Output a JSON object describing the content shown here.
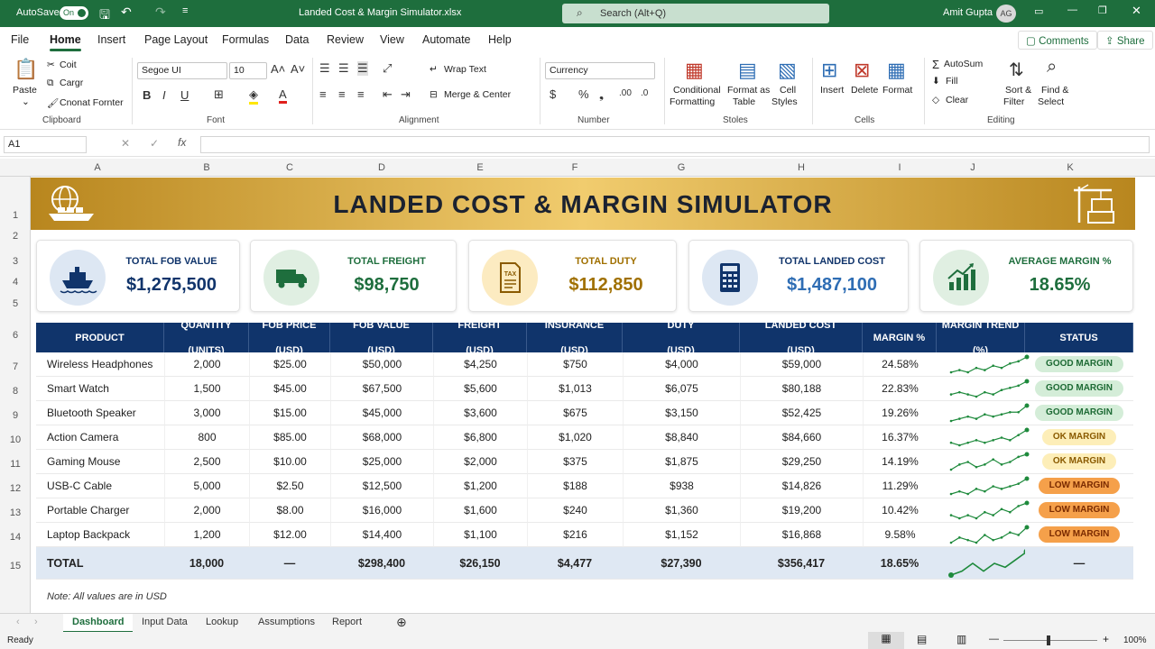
{
  "titlebar": {
    "autosave": "AutoSave",
    "toggle": "On",
    "filename": "Landed Cost & Margin Simulator.xlsx",
    "search": "Search (Alt+Q)",
    "user": "Amit Gupta",
    "initials": "AG"
  },
  "menu": [
    "File",
    "Home",
    "Insert",
    "Page Layout",
    "Formulas",
    "Data",
    "Review",
    "View",
    "Automate",
    "Help"
  ],
  "comments": "Comments",
  "share": "Share",
  "ribbon": {
    "paste": "Paste",
    "cut": "Coit",
    "copy": "Cargr",
    "format_painter": "Cnonat Fornter",
    "font_name": "Segoe UI",
    "font_size": "10",
    "wrap": "Wrap Text",
    "merge": "Merge & Center",
    "number_format": "Currency",
    "cond1": "Conditional",
    "cond2": "Formatting",
    "fmt1": "Format as",
    "fmt2": "Table",
    "cs1": "Cell",
    "cs2": "Styles",
    "insert": "Insert",
    "delete": "Delete",
    "format": "Format",
    "autosum": "AutoSum",
    "fill": "Fill",
    "clear": "Clear",
    "sort1": "Sort &",
    "sort2": "Filter",
    "find1": "Find &",
    "find2": "Select",
    "groups": {
      "clipboard": "Clipboard",
      "font": "Font",
      "alignment": "Alignment",
      "number": "Number",
      "styles": "Stoles",
      "cells": "Cells",
      "editing": "Editing"
    }
  },
  "namebox": "A1",
  "columns": [
    "A",
    "B",
    "C",
    "D",
    "E",
    "F",
    "G",
    "H",
    "I",
    "J",
    "K"
  ],
  "rows": [
    "1",
    "2",
    "3",
    "4",
    "5",
    "6",
    "7",
    "8",
    "9",
    "10",
    "11",
    "12",
    "13",
    "14",
    "15"
  ],
  "banner_title": "LANDED COST & MARGIN SIMULATOR",
  "kpis": [
    {
      "label": "TOTAL FOB VALUE",
      "value": "$1,275,500"
    },
    {
      "label": "TOTAL FREIGHT",
      "value": "$98,750"
    },
    {
      "label": "TOTAL DUTY",
      "value": "$112,850",
      "tax": "TAX"
    },
    {
      "label": "TOTAL LANDED COST",
      "value": "$1,487,100"
    },
    {
      "label": "AVERAGE MARGIN %",
      "value": "18.65%"
    }
  ],
  "headers": [
    {
      "l1": "PRODUCT",
      "l2": ""
    },
    {
      "l1": "QUANTITY",
      "l2": "(UNITS)"
    },
    {
      "l1": "FOB PRICE",
      "l2": "(USD)"
    },
    {
      "l1": "FOB VALUE",
      "l2": "(USD)"
    },
    {
      "l1": "FREIGHT",
      "l2": "(USD)"
    },
    {
      "l1": "INSURANCE",
      "l2": "(USD)"
    },
    {
      "l1": "DUTY",
      "l2": "(USD)"
    },
    {
      "l1": "LANDED COST",
      "l2": "(USD)"
    },
    {
      "l1": "MARGIN %",
      "l2": ""
    },
    {
      "l1": "MARGIN TREND",
      "l2": "(%)"
    },
    {
      "l1": "STATUS",
      "l2": ""
    }
  ],
  "products": [
    {
      "name": "Wireless Headphones",
      "qty": "2,000",
      "price": "$25.00",
      "fob": "$50,000",
      "freight": "$4,250",
      "ins": "$750",
      "duty": "$4,000",
      "landed": "$59,000",
      "margin": "24.58%",
      "status": "GOOD MARGIN",
      "trend": [
        2,
        3,
        2,
        4,
        3,
        5,
        4,
        6,
        7,
        9
      ]
    },
    {
      "name": "Smart Watch",
      "qty": "1,500",
      "price": "$45.00",
      "fob": "$67,500",
      "freight": "$5,600",
      "ins": "$1,013",
      "duty": "$6,075",
      "landed": "$80,188",
      "margin": "22.83%",
      "status": "GOOD MARGIN",
      "trend": [
        3,
        4,
        3,
        2,
        4,
        3,
        5,
        6,
        7,
        9
      ]
    },
    {
      "name": "Bluetooth Speaker",
      "qty": "3,000",
      "price": "$15.00",
      "fob": "$45,000",
      "freight": "$3,600",
      "ins": "$675",
      "duty": "$3,150",
      "landed": "$52,425",
      "margin": "19.26%",
      "status": "GOOD MARGIN",
      "trend": [
        2,
        3,
        4,
        3,
        5,
        4,
        5,
        6,
        6,
        9
      ]
    },
    {
      "name": "Action Camera",
      "qty": "800",
      "price": "$85.00",
      "fob": "$68,000",
      "freight": "$6,800",
      "ins": "$1,020",
      "duty": "$8,840",
      "landed": "$84,660",
      "margin": "16.37%",
      "status": "OK MARGIN",
      "trend": [
        3,
        2,
        3,
        4,
        3,
        4,
        5,
        4,
        6,
        8
      ]
    },
    {
      "name": "Gaming Mouse",
      "qty": "2,500",
      "price": "$10.00",
      "fob": "$25,000",
      "freight": "$2,000",
      "ins": "$375",
      "duty": "$1,875",
      "landed": "$29,250",
      "margin": "14.19%",
      "status": "OK MARGIN",
      "trend": [
        2,
        4,
        5,
        3,
        4,
        6,
        4,
        5,
        7,
        8
      ]
    },
    {
      "name": "USB-C Cable",
      "qty": "5,000",
      "price": "$2.50",
      "fob": "$12,500",
      "freight": "$1,200",
      "ins": "$188",
      "duty": "$938",
      "landed": "$14,826",
      "margin": "11.29%",
      "status": "LOW MARGIN",
      "trend": [
        2,
        3,
        2,
        4,
        3,
        5,
        4,
        5,
        6,
        8
      ]
    },
    {
      "name": "Portable Charger",
      "qty": "2,000",
      "price": "$8.00",
      "fob": "$16,000",
      "freight": "$1,600",
      "ins": "$240",
      "duty": "$1,360",
      "landed": "$19,200",
      "margin": "10.42%",
      "status": "LOW MARGIN",
      "trend": [
        3,
        2,
        3,
        2,
        4,
        3,
        5,
        4,
        6,
        7
      ]
    },
    {
      "name": "Laptop Backpack",
      "qty": "1,200",
      "price": "$12.00",
      "fob": "$14,400",
      "freight": "$1,100",
      "ins": "$216",
      "duty": "$1,152",
      "landed": "$16,868",
      "margin": "9.58%",
      "status": "LOW MARGIN",
      "trend": [
        2,
        4,
        3,
        2,
        5,
        3,
        4,
        6,
        5,
        8
      ]
    }
  ],
  "total": {
    "name": "TOTAL",
    "qty": "18,000",
    "price": "—",
    "fob": "$298,400",
    "freight": "$26,150",
    "ins": "$4,477",
    "duty": "$27,390",
    "landed": "$356,417",
    "margin": "18.65%",
    "status": "—",
    "trend": [
      2,
      3,
      5,
      3,
      5,
      4,
      6,
      8
    ]
  },
  "status_colors": {
    "GOOD MARGIN": {
      "bg": "#d4edd8",
      "fg": "#1d6a34"
    },
    "OK MARGIN": {
      "bg": "#fdeeb8",
      "fg": "#8a5a00"
    },
    "LOW MARGIN": {
      "bg": "#f5a04a",
      "fg": "#7a2a00"
    }
  },
  "note": "Note: All values are in USD",
  "sheets": [
    "Dashboard",
    "Input Data",
    "Lookup",
    "Assumptions",
    "Report"
  ],
  "statusbar": {
    "ready": "Ready",
    "zoom": "100%"
  },
  "colors": {
    "title_green": "#1e6e3d",
    "header_navy": "#10346b",
    "gold": "#d8a93a"
  }
}
